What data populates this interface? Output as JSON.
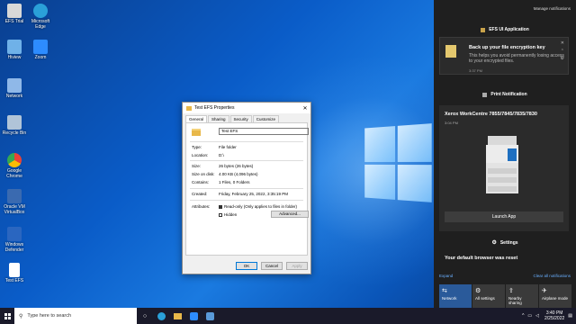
{
  "desktop": {
    "icons": [
      {
        "label": "EFS Trial",
        "icon": "file-icon",
        "color": "#d8d8d8"
      },
      {
        "label": "Microsoft Edge",
        "icon": "edge-icon",
        "color": "#2aa0d8"
      },
      {
        "label": "Hiview",
        "icon": "monitor-icon",
        "color": "#6fb1e8"
      },
      {
        "label": "Zoom",
        "icon": "zoom-icon",
        "color": "#2d8cff"
      },
      {
        "label": "Network",
        "icon": "network-icon",
        "color": "#8fb8e8"
      },
      {
        "label": "Recycle Bin",
        "icon": "recycle-bin-icon",
        "color": "#b0c4d8"
      },
      {
        "label": "Google Chrome",
        "icon": "chrome-icon",
        "color": "#e8a33a"
      },
      {
        "label": "Oracle VM VirtualBox",
        "icon": "virtualbox-icon",
        "color": "#3a6ab0"
      },
      {
        "label": "Windows Defender",
        "icon": "shield-icon",
        "color": "#2a66c0"
      },
      {
        "label": "Test EFS",
        "icon": "document-icon",
        "color": "#ffffff"
      }
    ]
  },
  "dialog": {
    "title": "Test EFS Properties",
    "close": "✕",
    "tabs": [
      "General",
      "Sharing",
      "Security",
      "Customize"
    ],
    "name_value": "Test EFS",
    "fields": {
      "type_label": "Type:",
      "type_value": "File folder",
      "location_label": "Location:",
      "location_value": "D:\\",
      "size_label": "Size:",
      "size_value": "26 bytes (26 bytes)",
      "size_on_disk_label": "Size on disk:",
      "size_on_disk_value": "4.00 KB (4,096 bytes)",
      "contains_label": "Contains:",
      "contains_value": "1 Files, 0 Folders",
      "created_label": "Created:",
      "created_value": "Friday, February 25, 2022, 3:35:19 PM",
      "attributes_label": "Attributes:"
    },
    "readonly_label": "Read-only (Only applies to files in folder)",
    "hidden_label": "Hidden",
    "advanced_button": "Advanced...",
    "ok_button": "OK",
    "cancel_button": "Cancel",
    "apply_button": "Apply"
  },
  "action_center": {
    "manage": "Manage notifications",
    "app1": "EFS UI Application",
    "toast_title": "Back up your file encryption key",
    "toast_body": "This helps you avoid permanently losing access to your encrypted files.",
    "toast_time": "3:37 PM",
    "toast_close": "✕",
    "toast_chevron": "⌃",
    "toast_gear": "⚙",
    "app2": "Print Notification",
    "printer_title": "Xerox WorkCentre 7855/7845/7835/7830",
    "printer_time": "3:04 PM",
    "launch_button": "Launch App",
    "app3": "Settings",
    "default_browser": "Your default browser was reset",
    "expand": "Expand",
    "clear_all": "Clear all notifications",
    "quick_actions": [
      {
        "label": "Network",
        "icon": "network-icon",
        "glyph": "⇆"
      },
      {
        "label": "All settings",
        "icon": "gear-icon",
        "glyph": "⚙"
      },
      {
        "label": "Nearby sharing",
        "icon": "share-icon",
        "glyph": "⇪"
      },
      {
        "label": "Airplane mode",
        "icon": "airplane-icon",
        "glyph": "✈"
      }
    ]
  },
  "taskbar": {
    "search_placeholder": "Type here to search",
    "time": "3:40 PM",
    "date": "2/25/2022",
    "accent": "#0078d7"
  }
}
